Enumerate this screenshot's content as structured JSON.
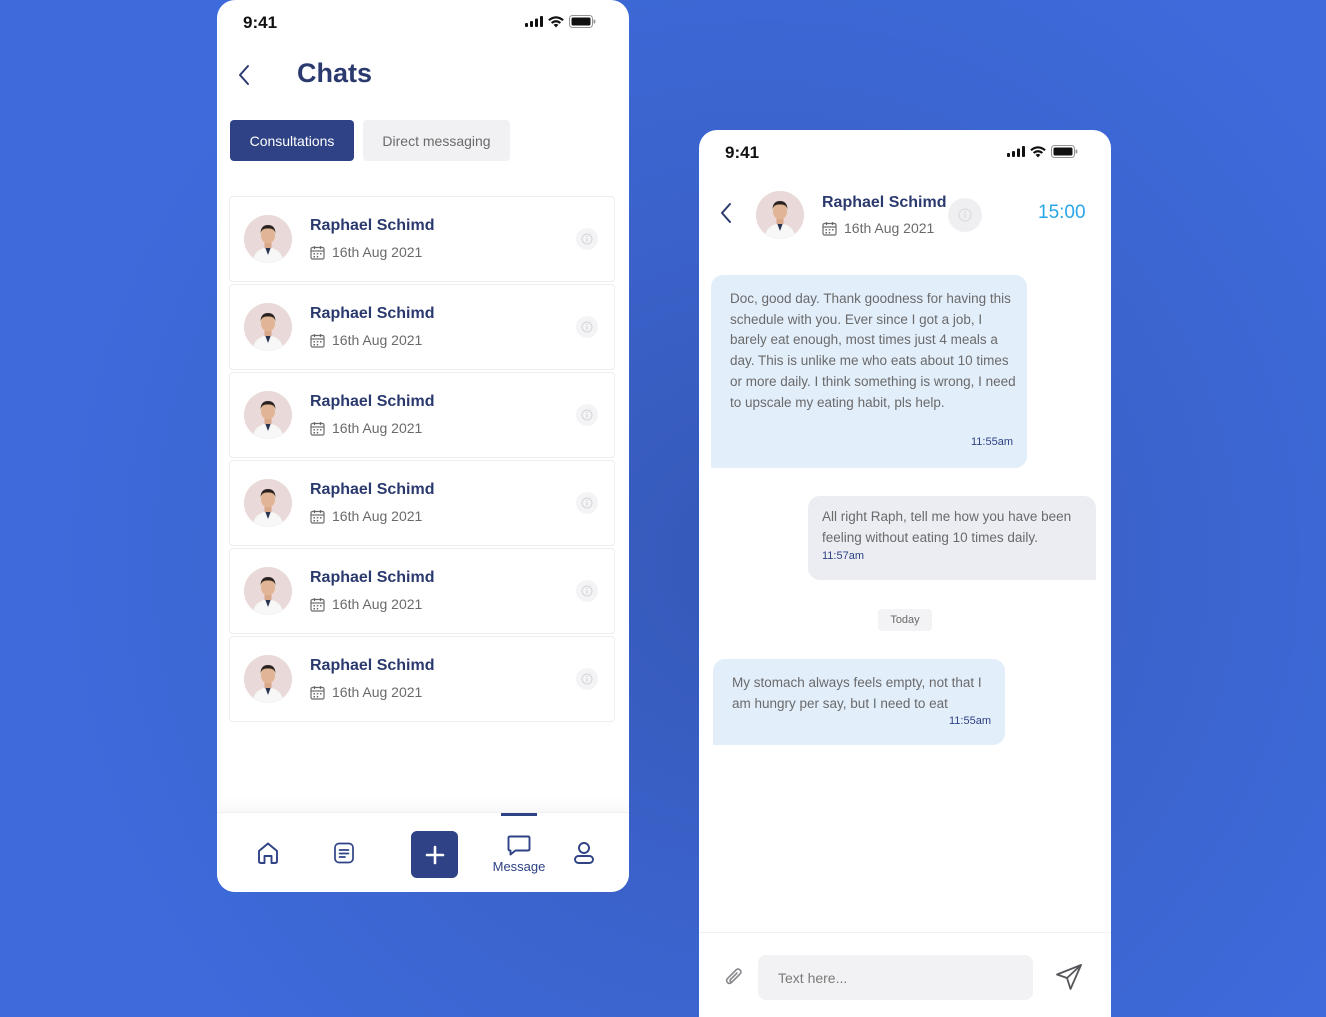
{
  "colors": {
    "background": "#3d69d6",
    "primary": "#2e4285",
    "accent_time": "#28a6e8",
    "incoming_bubble": "#e3eefb",
    "outgoing_bubble": "#ebedf2"
  },
  "left_phone": {
    "status_time": "9:41",
    "title": "Chats",
    "tabs": [
      {
        "label": "Consultations",
        "active": true
      },
      {
        "label": "Direct messaging",
        "active": false
      }
    ],
    "chats": [
      {
        "name": "Raphael Schimd",
        "date": "16th Aug 2021"
      },
      {
        "name": "Raphael Schimd",
        "date": "16th Aug 2021"
      },
      {
        "name": "Raphael Schimd",
        "date": "16th Aug 2021"
      },
      {
        "name": "Raphael Schimd",
        "date": "16th Aug 2021"
      },
      {
        "name": "Raphael Schimd",
        "date": "16th Aug 2021"
      },
      {
        "name": "Raphael Schimd",
        "date": "16th Aug 2021"
      }
    ],
    "nav": {
      "items": [
        "home-icon",
        "document-icon",
        "plus-icon",
        "message-icon",
        "profile-icon"
      ],
      "active_label": "Message"
    }
  },
  "right_phone": {
    "status_time": "9:41",
    "contact_name": "Raphael Schimd",
    "contact_date": "16th Aug 2021",
    "timer": "15:00",
    "messages": [
      {
        "direction": "in",
        "text": "Doc, good day. Thank goodness for having this schedule with you. Ever since I got a job, I barely eat enough, most times just 4 meals a day. This is unlike me who eats about 10 times or more daily. I think something is wrong, I need to upscale my eating habit, pls help.",
        "time": "11:55am"
      },
      {
        "direction": "out",
        "text": "All right Raph, tell me how you have been feeling without eating 10 times daily.",
        "time": "11:57am"
      },
      {
        "direction": "in",
        "text": "My stomach always feels empty, not that I am hungry per say, but I need to eat",
        "time": "11:55am"
      }
    ],
    "day_separator": "Today",
    "composer": {
      "placeholder": "Text here..."
    }
  }
}
